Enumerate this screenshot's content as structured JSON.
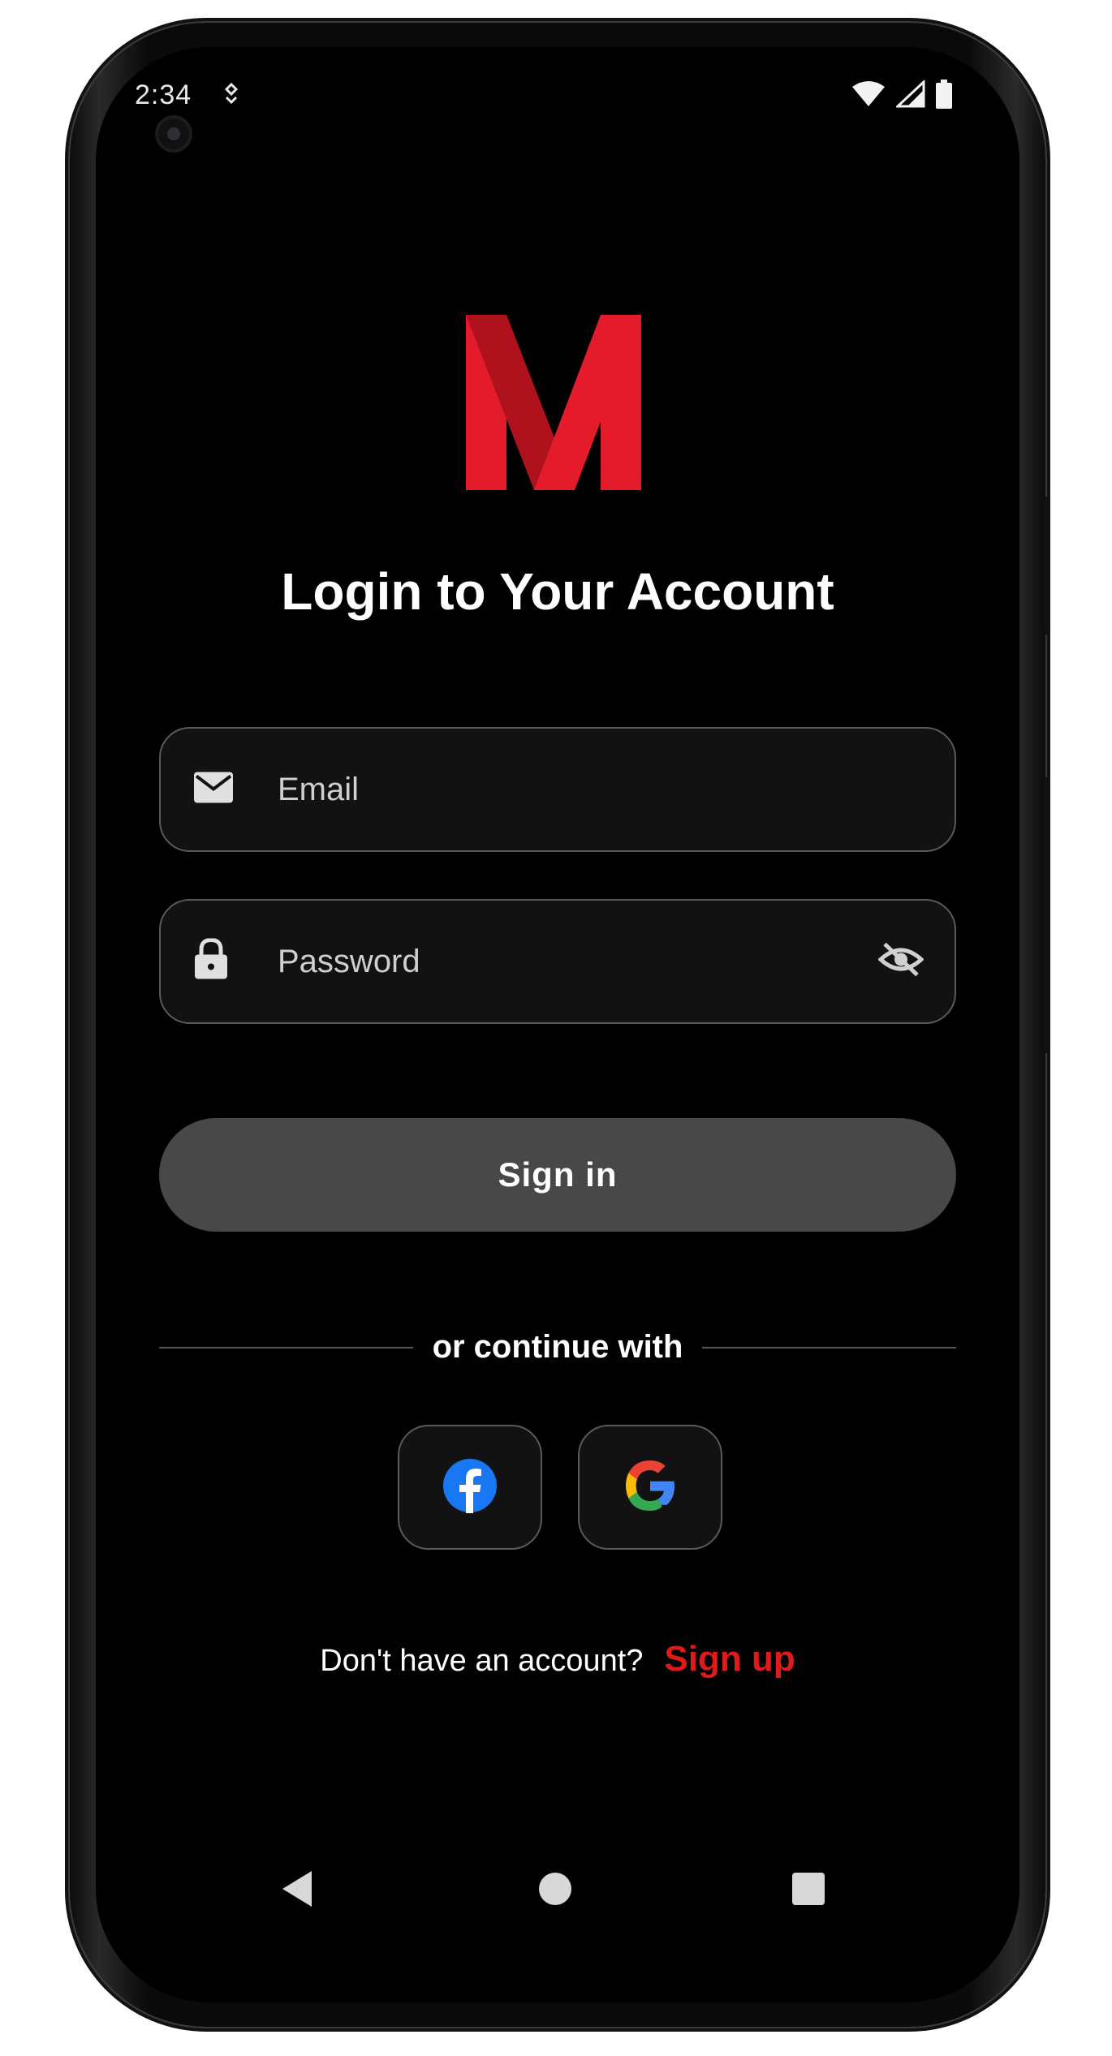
{
  "status_bar": {
    "time": "2:34",
    "icons": [
      "notification-icon",
      "wifi-icon",
      "signal-icon",
      "battery-icon"
    ]
  },
  "logo": {
    "icon": "m-logo-icon",
    "colors": {
      "primary": "#e31b2a",
      "shade": "#b0121d"
    }
  },
  "title": "Login to Your Account",
  "form": {
    "email": {
      "placeholder": "Email",
      "value": "",
      "icon": "mail-icon"
    },
    "password": {
      "placeholder": "Password",
      "value": "",
      "icon": "lock-icon",
      "toggle_icon": "eye-off-icon"
    },
    "signin_label": "Sign in"
  },
  "divider_text": "or continue with",
  "social": [
    {
      "name": "facebook",
      "icon": "facebook-icon",
      "color": "#1877f2"
    },
    {
      "name": "google",
      "icon": "google-icon"
    }
  ],
  "signup": {
    "prompt": "Don't have an account?",
    "link_label": "Sign up",
    "link_color": "#e01a1a"
  },
  "nav_bar": {
    "icons": [
      "back-icon",
      "home-icon",
      "recents-icon"
    ]
  },
  "theme": {
    "background": "#000000",
    "field_background": "#121212",
    "field_border": "#5a5a5a",
    "button_background": "#484848",
    "accent": "#e01a1a"
  }
}
